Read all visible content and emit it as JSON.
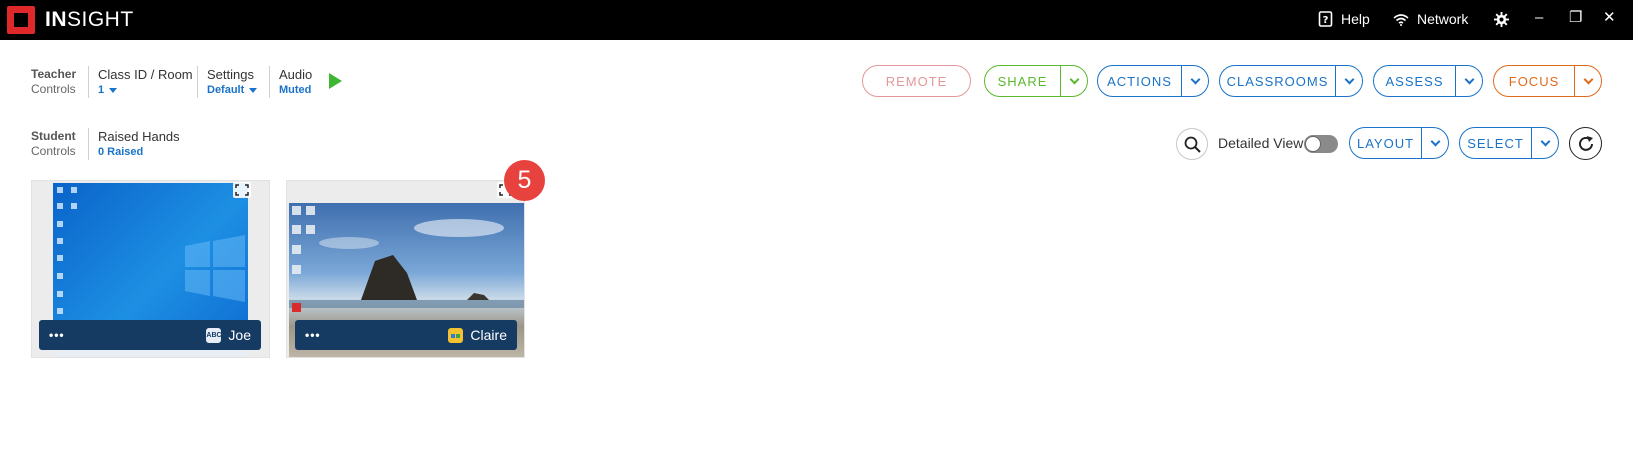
{
  "app": {
    "brand_bold": "IN",
    "brand_light": "SIGHT"
  },
  "titlebar": {
    "help_label": "Help",
    "network_label": "Network",
    "settings_icon": "gear-icon",
    "minimize": "–",
    "restore": "❐",
    "close": "✕"
  },
  "teacher": {
    "label_1": "Teacher",
    "label_2": "Controls",
    "class_label": "Class ID / Room",
    "class_value": "1",
    "settings_label": "Settings",
    "settings_value": "Default",
    "audio_label": "Audio",
    "audio_value": "Muted"
  },
  "toolbar": {
    "remote": "REMOTE",
    "share": "SHARE",
    "actions": "ACTIONS",
    "classrooms": "CLASSROOMS",
    "assess": "ASSESS",
    "focus": "FOCUS"
  },
  "student": {
    "label_1": "Student",
    "label_2": "Controls",
    "raised_label": "Raised Hands",
    "raised_value": "0 Raised",
    "detailed_view": "Detailed View",
    "layout": "LAYOUT",
    "select": "SELECT"
  },
  "tiles": [
    {
      "name": "Joe",
      "menu": "•••"
    },
    {
      "name": "Claire",
      "menu": "•••",
      "badge": "5"
    }
  ],
  "colors": {
    "share": "#5cb82e",
    "focus": "#e06a1b",
    "remote": "#e2989a",
    "accent": "#1a73c8",
    "badge": "#e8423f"
  }
}
